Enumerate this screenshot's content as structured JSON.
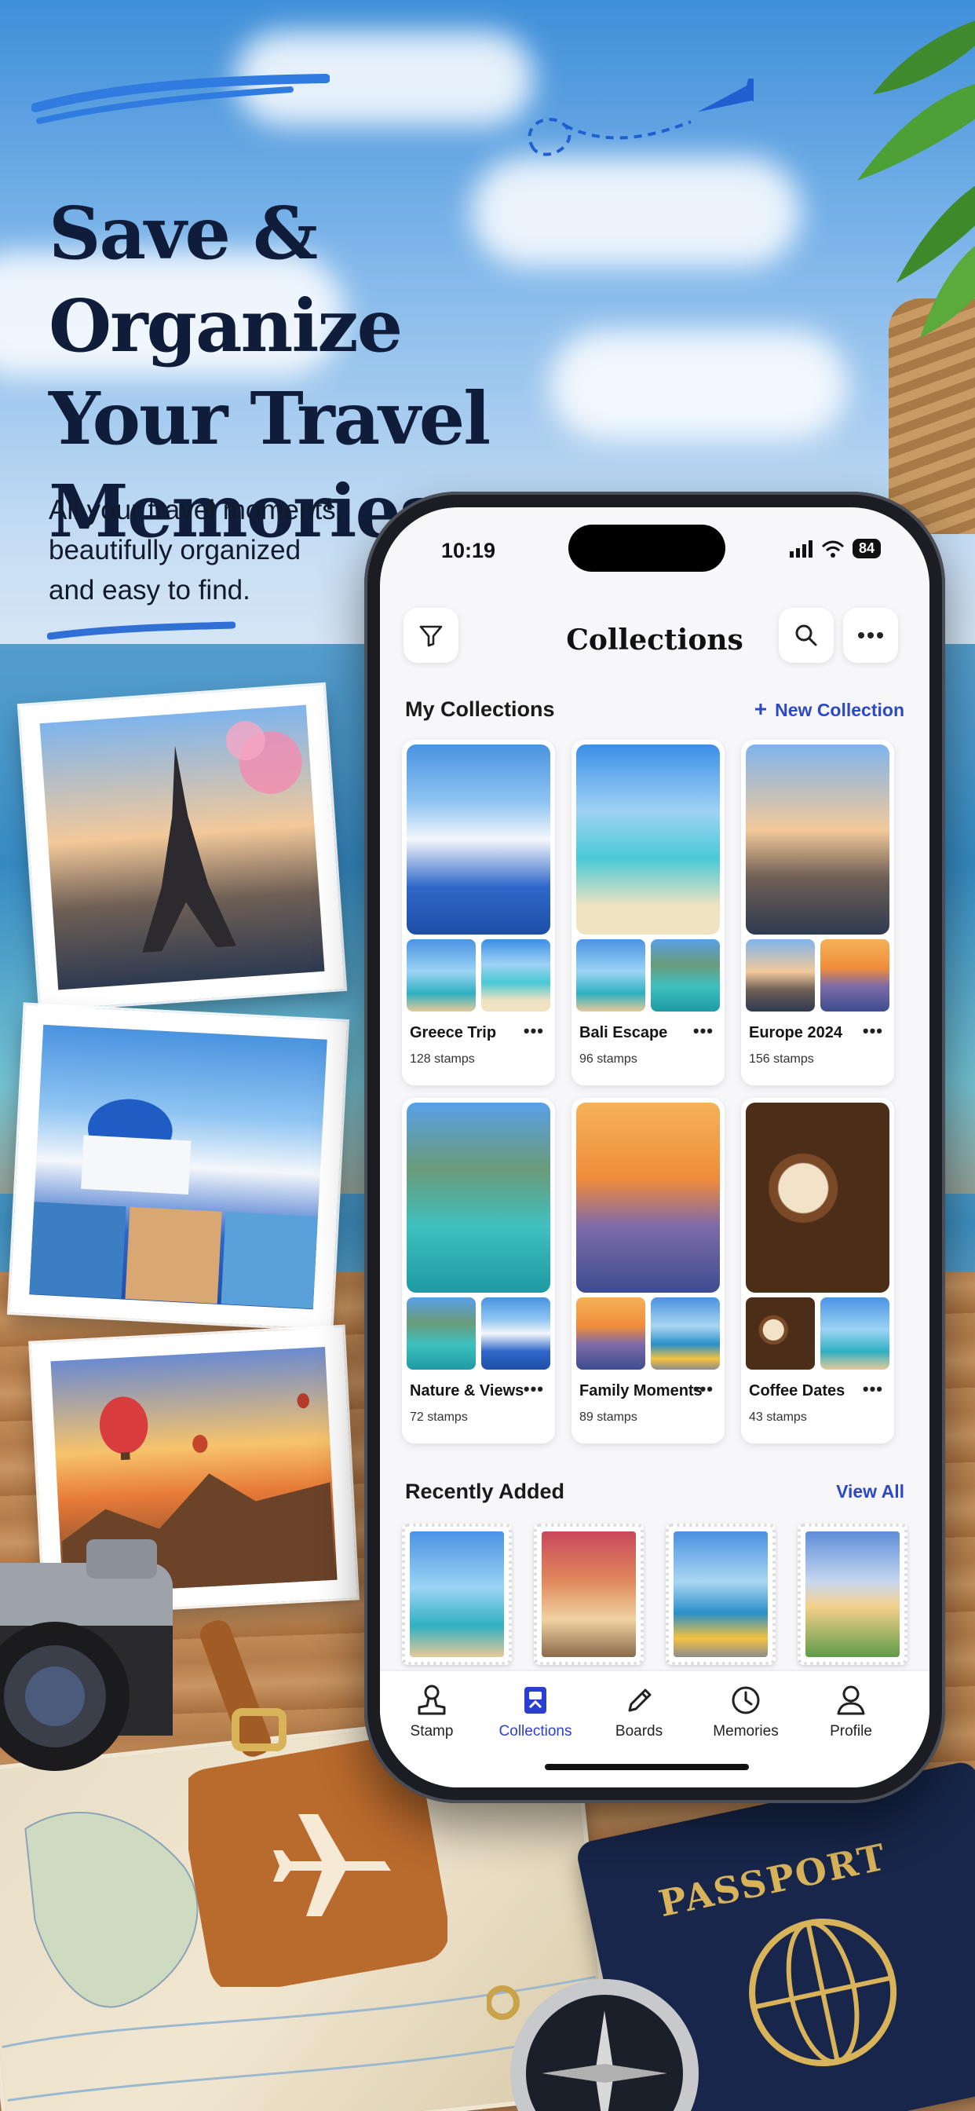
{
  "hero": {
    "title_line1": "Save & Organize",
    "title_line2": "Your Travel",
    "title_line3": "Memories",
    "subtitle_line1": "All your travel moments,",
    "subtitle_line2": "beautifully organized",
    "subtitle_line3": "and easy to find."
  },
  "status": {
    "time": "10:19",
    "battery": "84"
  },
  "topbar": {
    "title": "Collections"
  },
  "my_collections": {
    "title": "My Collections",
    "new_label": "New Collection",
    "items": [
      {
        "name": "Greece Trip",
        "count": "128 stamps",
        "more": "•••"
      },
      {
        "name": "Bali Escape",
        "count": "96 stamps",
        "more": "•••"
      },
      {
        "name": "Europe 2024",
        "count": "156 stamps",
        "more": "•••"
      },
      {
        "name": "Nature & Views",
        "count": "72 stamps",
        "more": "•••"
      },
      {
        "name": "Family Moments",
        "count": "89 stamps",
        "more": "•••"
      },
      {
        "name": "Coffee Dates",
        "count": "43 stamps",
        "more": "•••"
      }
    ]
  },
  "recently_added": {
    "title": "Recently Added",
    "view_all": "View All"
  },
  "tabs": [
    {
      "label": "Stamp",
      "icon": "stamp-icon"
    },
    {
      "label": "Collections",
      "icon": "collections-icon",
      "active": true
    },
    {
      "label": "Boards",
      "icon": "pencil-icon"
    },
    {
      "label": "Memories",
      "icon": "clock-icon"
    },
    {
      "label": "Profile",
      "icon": "person-icon"
    }
  ],
  "props": {
    "passport_text": "PASSPORT"
  },
  "colors": {
    "accent": "#2a3fd1",
    "title_navy": "#0f1d3a",
    "brush_blue": "#2f7be0"
  }
}
